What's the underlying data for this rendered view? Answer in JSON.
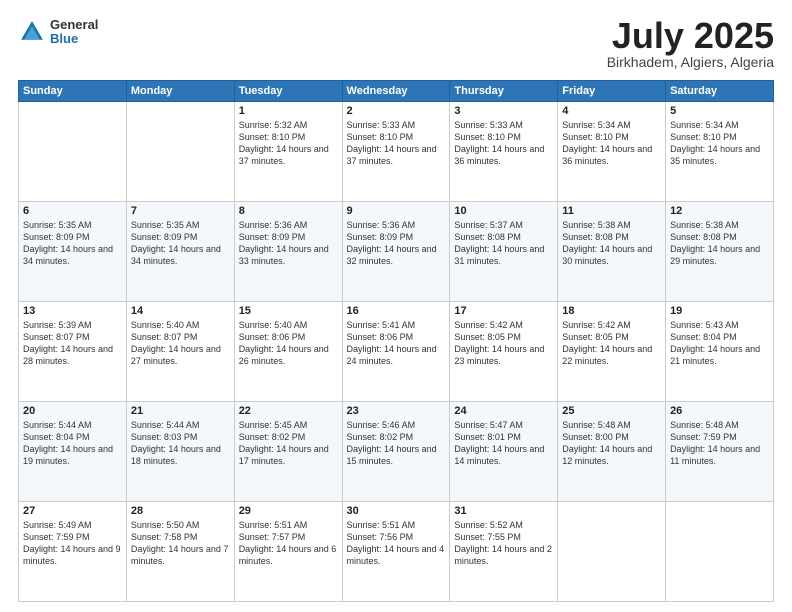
{
  "header": {
    "logo_general": "General",
    "logo_blue": "Blue",
    "month_title": "July 2025",
    "subtitle": "Birkhadem, Algiers, Algeria"
  },
  "days_of_week": [
    "Sunday",
    "Monday",
    "Tuesday",
    "Wednesday",
    "Thursday",
    "Friday",
    "Saturday"
  ],
  "weeks": [
    [
      {
        "day": null,
        "info": null
      },
      {
        "day": null,
        "info": null
      },
      {
        "day": "1",
        "info": "Sunrise: 5:32 AM\nSunset: 8:10 PM\nDaylight: 14 hours and 37 minutes."
      },
      {
        "day": "2",
        "info": "Sunrise: 5:33 AM\nSunset: 8:10 PM\nDaylight: 14 hours and 37 minutes."
      },
      {
        "day": "3",
        "info": "Sunrise: 5:33 AM\nSunset: 8:10 PM\nDaylight: 14 hours and 36 minutes."
      },
      {
        "day": "4",
        "info": "Sunrise: 5:34 AM\nSunset: 8:10 PM\nDaylight: 14 hours and 36 minutes."
      },
      {
        "day": "5",
        "info": "Sunrise: 5:34 AM\nSunset: 8:10 PM\nDaylight: 14 hours and 35 minutes."
      }
    ],
    [
      {
        "day": "6",
        "info": "Sunrise: 5:35 AM\nSunset: 8:09 PM\nDaylight: 14 hours and 34 minutes."
      },
      {
        "day": "7",
        "info": "Sunrise: 5:35 AM\nSunset: 8:09 PM\nDaylight: 14 hours and 34 minutes."
      },
      {
        "day": "8",
        "info": "Sunrise: 5:36 AM\nSunset: 8:09 PM\nDaylight: 14 hours and 33 minutes."
      },
      {
        "day": "9",
        "info": "Sunrise: 5:36 AM\nSunset: 8:09 PM\nDaylight: 14 hours and 32 minutes."
      },
      {
        "day": "10",
        "info": "Sunrise: 5:37 AM\nSunset: 8:08 PM\nDaylight: 14 hours and 31 minutes."
      },
      {
        "day": "11",
        "info": "Sunrise: 5:38 AM\nSunset: 8:08 PM\nDaylight: 14 hours and 30 minutes."
      },
      {
        "day": "12",
        "info": "Sunrise: 5:38 AM\nSunset: 8:08 PM\nDaylight: 14 hours and 29 minutes."
      }
    ],
    [
      {
        "day": "13",
        "info": "Sunrise: 5:39 AM\nSunset: 8:07 PM\nDaylight: 14 hours and 28 minutes."
      },
      {
        "day": "14",
        "info": "Sunrise: 5:40 AM\nSunset: 8:07 PM\nDaylight: 14 hours and 27 minutes."
      },
      {
        "day": "15",
        "info": "Sunrise: 5:40 AM\nSunset: 8:06 PM\nDaylight: 14 hours and 26 minutes."
      },
      {
        "day": "16",
        "info": "Sunrise: 5:41 AM\nSunset: 8:06 PM\nDaylight: 14 hours and 24 minutes."
      },
      {
        "day": "17",
        "info": "Sunrise: 5:42 AM\nSunset: 8:05 PM\nDaylight: 14 hours and 23 minutes."
      },
      {
        "day": "18",
        "info": "Sunrise: 5:42 AM\nSunset: 8:05 PM\nDaylight: 14 hours and 22 minutes."
      },
      {
        "day": "19",
        "info": "Sunrise: 5:43 AM\nSunset: 8:04 PM\nDaylight: 14 hours and 21 minutes."
      }
    ],
    [
      {
        "day": "20",
        "info": "Sunrise: 5:44 AM\nSunset: 8:04 PM\nDaylight: 14 hours and 19 minutes."
      },
      {
        "day": "21",
        "info": "Sunrise: 5:44 AM\nSunset: 8:03 PM\nDaylight: 14 hours and 18 minutes."
      },
      {
        "day": "22",
        "info": "Sunrise: 5:45 AM\nSunset: 8:02 PM\nDaylight: 14 hours and 17 minutes."
      },
      {
        "day": "23",
        "info": "Sunrise: 5:46 AM\nSunset: 8:02 PM\nDaylight: 14 hours and 15 minutes."
      },
      {
        "day": "24",
        "info": "Sunrise: 5:47 AM\nSunset: 8:01 PM\nDaylight: 14 hours and 14 minutes."
      },
      {
        "day": "25",
        "info": "Sunrise: 5:48 AM\nSunset: 8:00 PM\nDaylight: 14 hours and 12 minutes."
      },
      {
        "day": "26",
        "info": "Sunrise: 5:48 AM\nSunset: 7:59 PM\nDaylight: 14 hours and 11 minutes."
      }
    ],
    [
      {
        "day": "27",
        "info": "Sunrise: 5:49 AM\nSunset: 7:59 PM\nDaylight: 14 hours and 9 minutes."
      },
      {
        "day": "28",
        "info": "Sunrise: 5:50 AM\nSunset: 7:58 PM\nDaylight: 14 hours and 7 minutes."
      },
      {
        "day": "29",
        "info": "Sunrise: 5:51 AM\nSunset: 7:57 PM\nDaylight: 14 hours and 6 minutes."
      },
      {
        "day": "30",
        "info": "Sunrise: 5:51 AM\nSunset: 7:56 PM\nDaylight: 14 hours and 4 minutes."
      },
      {
        "day": "31",
        "info": "Sunrise: 5:52 AM\nSunset: 7:55 PM\nDaylight: 14 hours and 2 minutes."
      },
      {
        "day": null,
        "info": null
      },
      {
        "day": null,
        "info": null
      }
    ]
  ]
}
